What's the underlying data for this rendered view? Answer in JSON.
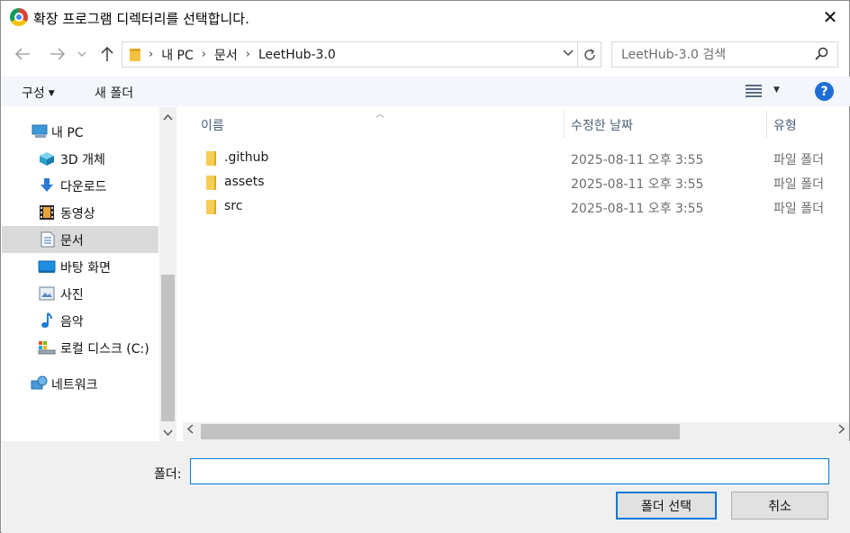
{
  "window": {
    "title": "확장 프로그램 디렉터리를 선택합니다.",
    "close_symbol": "✕"
  },
  "address": {
    "breadcrumbs": [
      "내 PC",
      "문서",
      "LeetHub-3.0"
    ],
    "search_placeholder": "LeetHub-3.0 검색"
  },
  "toolbar": {
    "organize_label": "구성",
    "new_folder_label": "새 폴더",
    "help_label": "?"
  },
  "sidebar": {
    "items": [
      {
        "label": "내 PC",
        "icon": "pc-icon"
      },
      {
        "label": "3D 개체",
        "icon": "3d-objects-icon"
      },
      {
        "label": "다운로드",
        "icon": "download-icon"
      },
      {
        "label": "동영상",
        "icon": "video-icon"
      },
      {
        "label": "문서",
        "icon": "document-icon",
        "selected": true
      },
      {
        "label": "바탕 화면",
        "icon": "desktop-icon"
      },
      {
        "label": "사진",
        "icon": "pictures-icon"
      },
      {
        "label": "음악",
        "icon": "music-icon"
      },
      {
        "label": "로컬 디스크 (C:)",
        "icon": "local-disk-icon"
      },
      {
        "label": "네트워크",
        "icon": "network-icon"
      }
    ]
  },
  "filelist": {
    "columns": [
      "이름",
      "수정한 날짜",
      "유형"
    ],
    "rows": [
      {
        "name": ".github",
        "date": "2025-08-11 오후 3:55",
        "type": "파일 폴더"
      },
      {
        "name": "assets",
        "date": "2025-08-11 오후 3:55",
        "type": "파일 폴더"
      },
      {
        "name": "src",
        "date": "2025-08-11 오후 3:55",
        "type": "파일 폴더"
      }
    ]
  },
  "footer": {
    "folder_label": "폴더:",
    "folder_value": "",
    "select_button": "폴더 선택",
    "cancel_button": "취소"
  }
}
